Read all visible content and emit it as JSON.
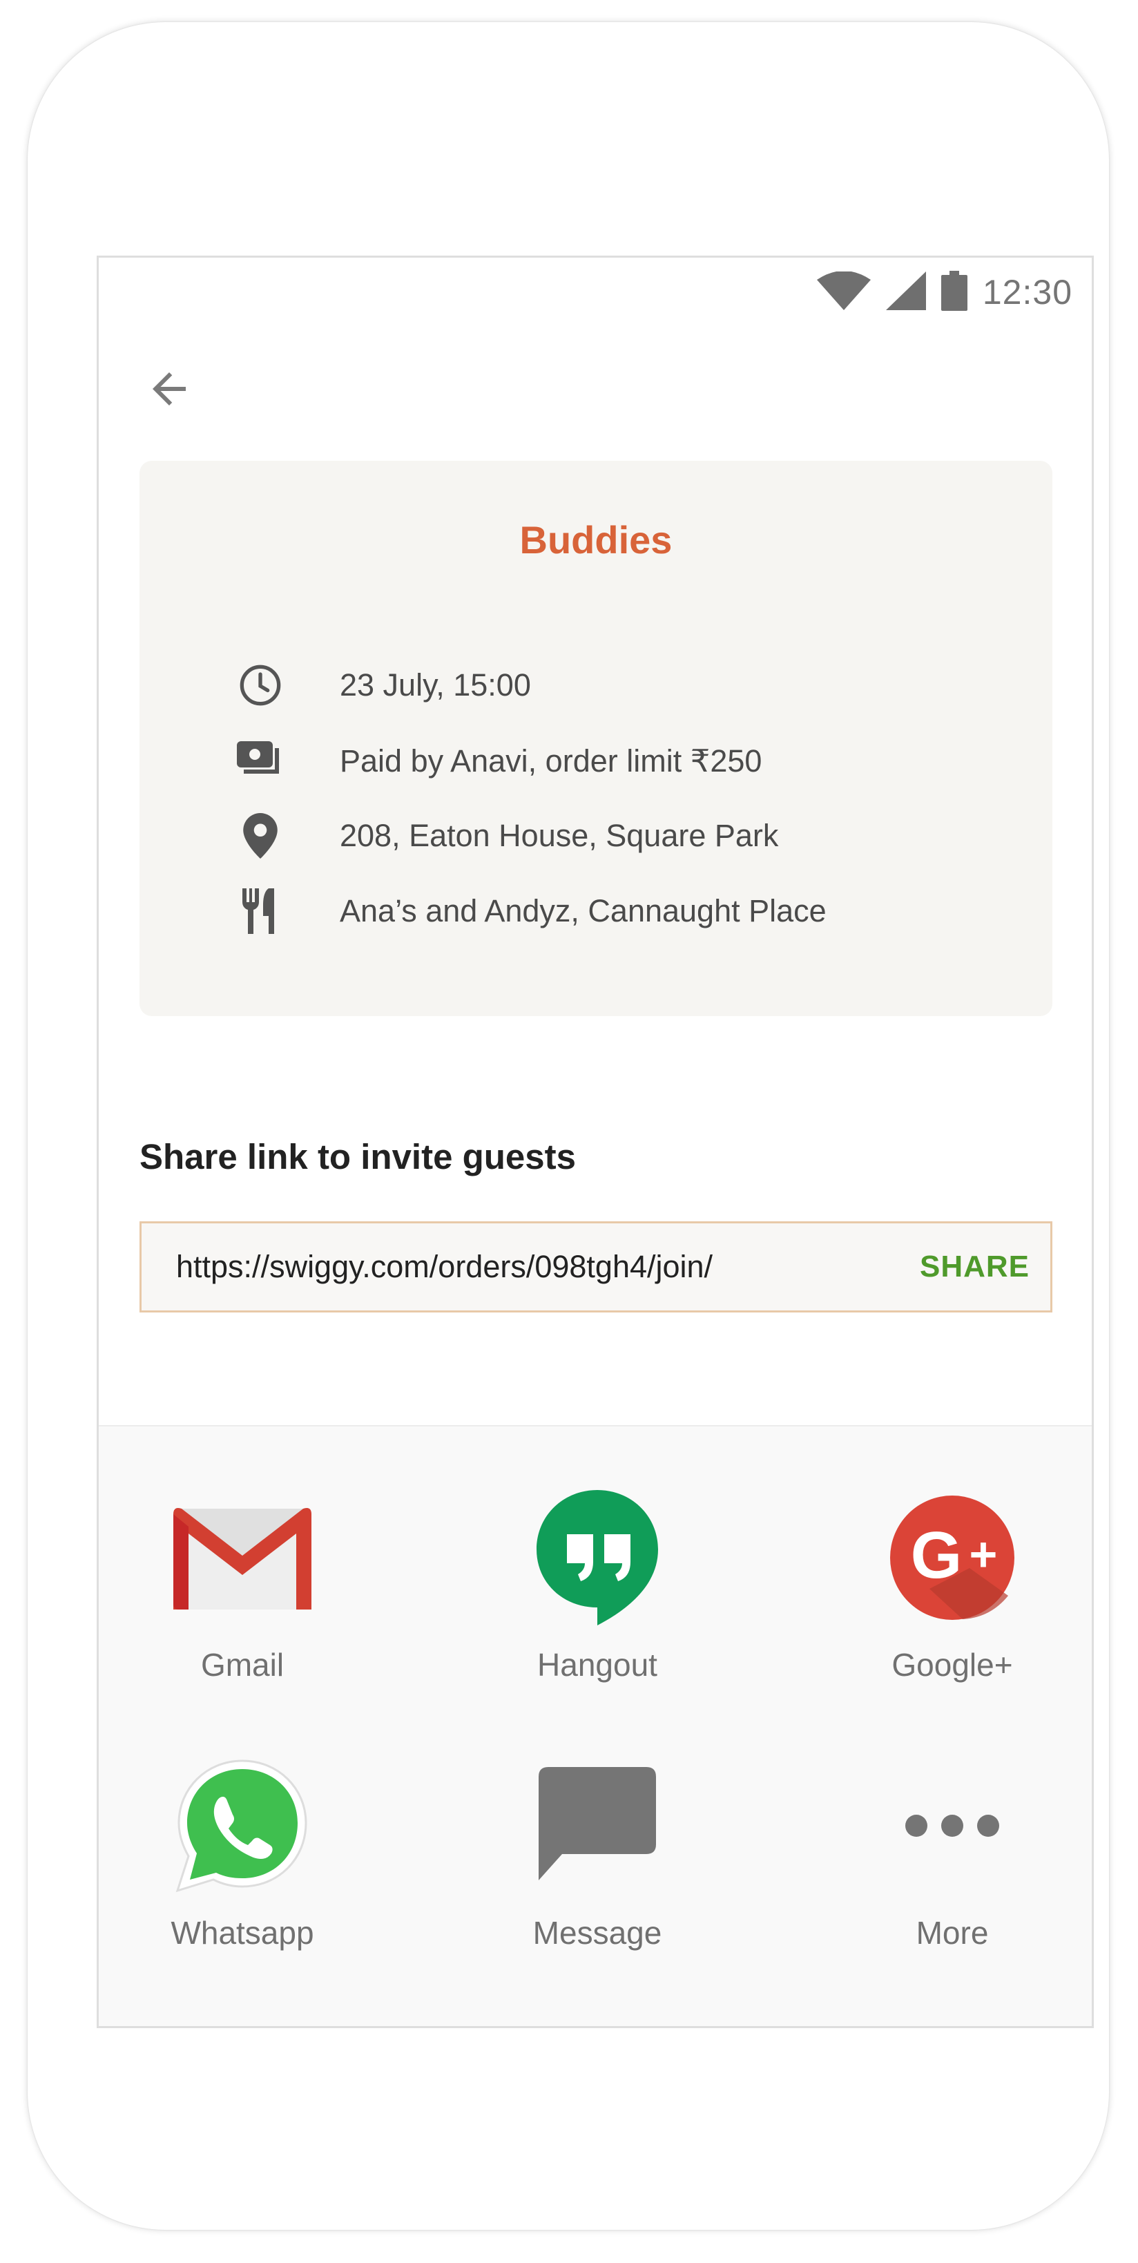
{
  "status_bar": {
    "time": "12:30",
    "icons": [
      "wifi-icon",
      "signal-icon",
      "battery-icon"
    ]
  },
  "navigation": {
    "back_icon": "arrow-back-icon"
  },
  "order_card": {
    "title": "Buddies",
    "title_color": "#d86339",
    "details": [
      {
        "icon": "clock-icon",
        "text": "23 July, 15:00"
      },
      {
        "icon": "money-icon",
        "text": "Paid by Anavi, order limit ₹250"
      },
      {
        "icon": "location-pin-icon",
        "text": "208, Eaton House, Square Park"
      },
      {
        "icon": "restaurant-icon",
        "text": "Ana’s and Andyz, Cannaught Place"
      }
    ]
  },
  "share": {
    "heading": "Share link to invite guests",
    "link": "https://swiggy.com/orders/098tgh4/join/",
    "button_label": "SHARE",
    "button_color": "#4f9a2b"
  },
  "share_sheet": {
    "apps": [
      {
        "icon": "gmail-icon",
        "label": "Gmail"
      },
      {
        "icon": "hangout-icon",
        "label": "Hangout"
      },
      {
        "icon": "google-plus-icon",
        "label": "Google+"
      },
      {
        "icon": "whatsapp-icon",
        "label": "Whatsapp"
      },
      {
        "icon": "message-icon",
        "label": "Message"
      },
      {
        "icon": "more-icon",
        "label": "More"
      }
    ]
  }
}
